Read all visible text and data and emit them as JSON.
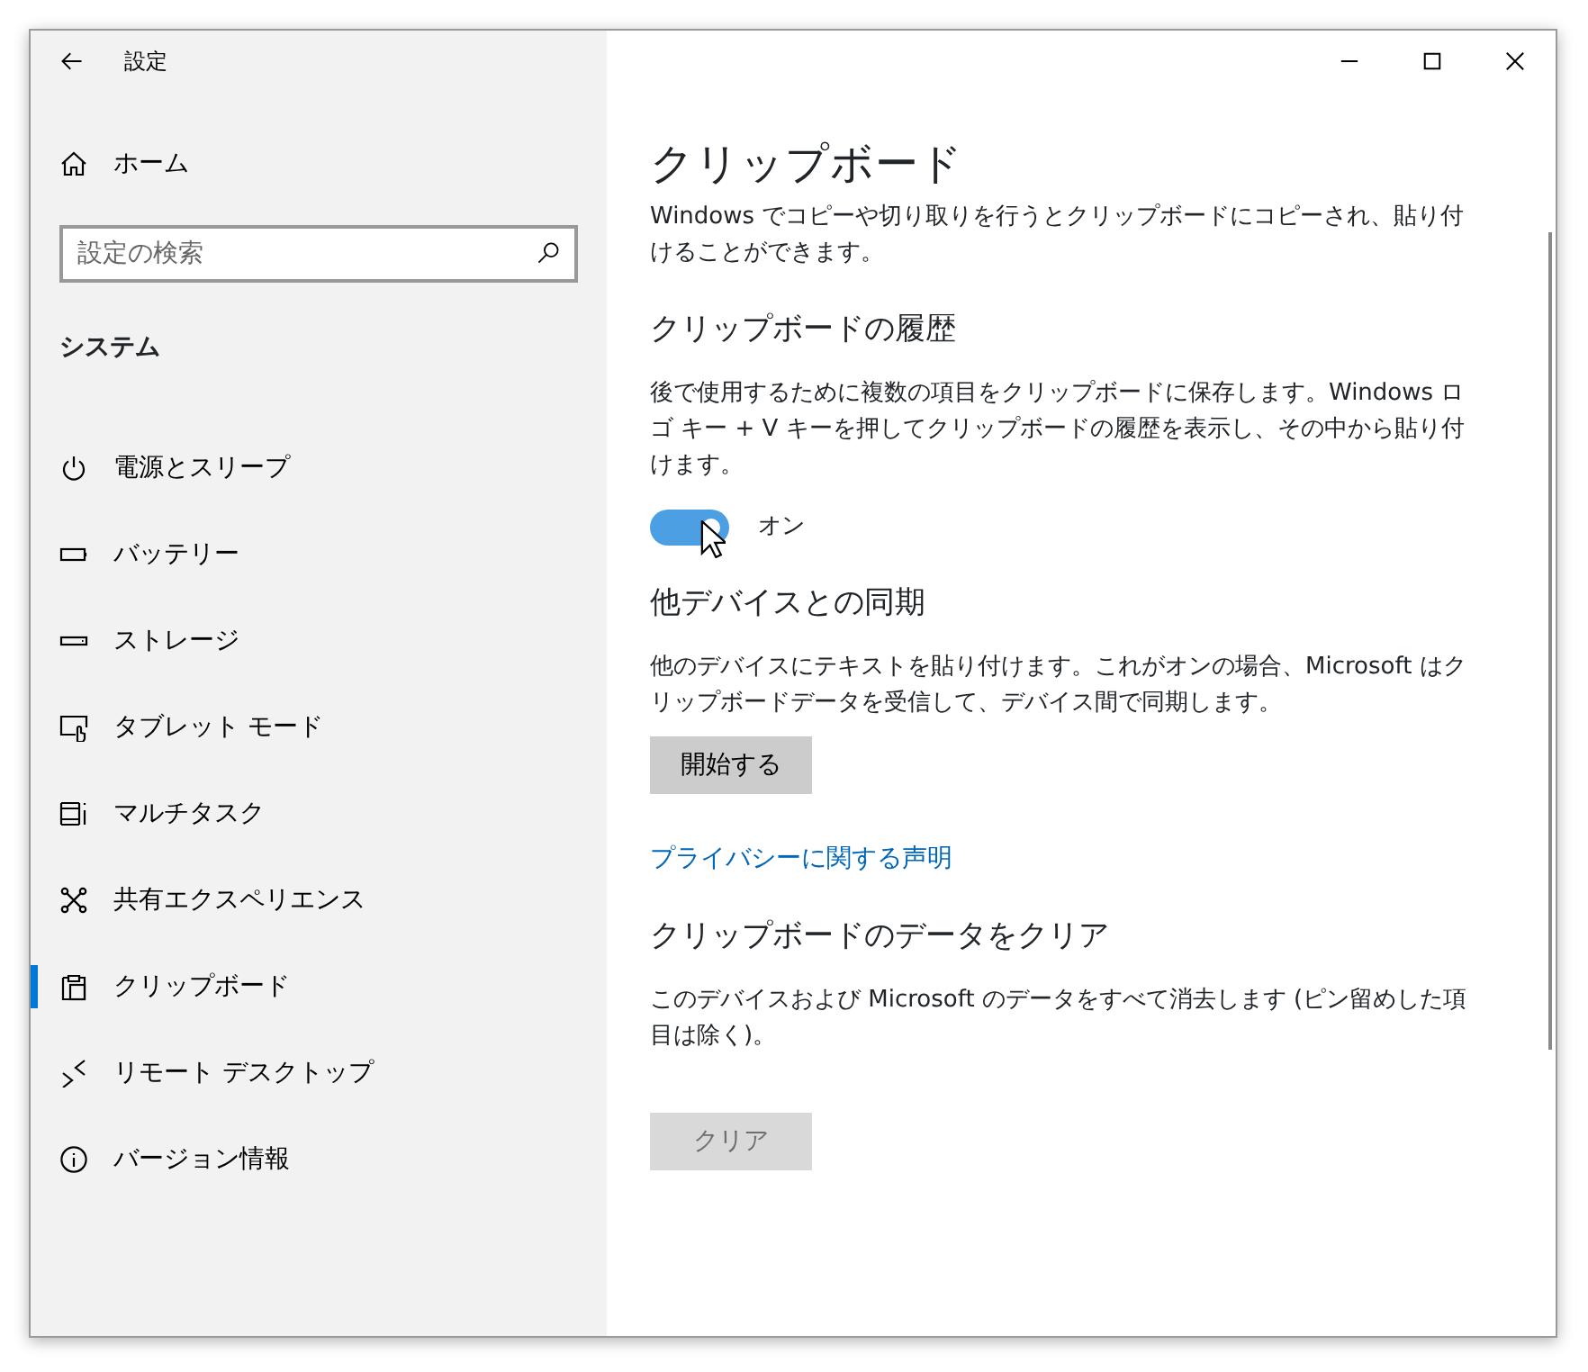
{
  "window": {
    "title": "設定"
  },
  "sidebar": {
    "home": {
      "label": "ホーム"
    },
    "search": {
      "placeholder": "設定の検索"
    },
    "section": "システム",
    "items": [
      {
        "label": "電源とスリープ",
        "selected": false
      },
      {
        "label": "バッテリー",
        "selected": false
      },
      {
        "label": "ストレージ",
        "selected": false
      },
      {
        "label": "タブレット モード",
        "selected": false
      },
      {
        "label": "マルチタスク",
        "selected": false
      },
      {
        "label": "共有エクスペリエンス",
        "selected": false
      },
      {
        "label": "クリップボード",
        "selected": true
      },
      {
        "label": "リモート デスクトップ",
        "selected": false
      },
      {
        "label": "バージョン情報",
        "selected": false
      }
    ]
  },
  "content": {
    "title": "クリップボード",
    "intro": "Windows でコピーや切り取りを行うとクリップボードにコピーされ、貼り付けることができます。",
    "sections": [
      {
        "kind": "toggle",
        "heading": "クリップボードの履歴",
        "description": "後で使用するために複数の項目をクリップボードに保存します。Windows ロゴ キー + V キーを押してクリップボードの履歴を表示し、その中から貼り付けます。",
        "toggle": {
          "on": true,
          "label": "オン"
        }
      },
      {
        "kind": "button",
        "heading": "他デバイスとの同期",
        "description": "他のデバイスにテキストを貼り付けます。これがオンの場合、Microsoft はクリップボードデータを受信して、デバイス間で同期します。",
        "button": {
          "label": "開始する",
          "disabled": false
        }
      },
      {
        "kind": "link",
        "label": "プライバシーに関する声明"
      },
      {
        "kind": "button",
        "heading": "クリップボードのデータをクリア",
        "description": "このデバイスおよび Microsoft のデータをすべて消去します (ピン留めした項目は除く)。",
        "button": {
          "label": "クリア",
          "disabled": true
        }
      }
    ]
  }
}
